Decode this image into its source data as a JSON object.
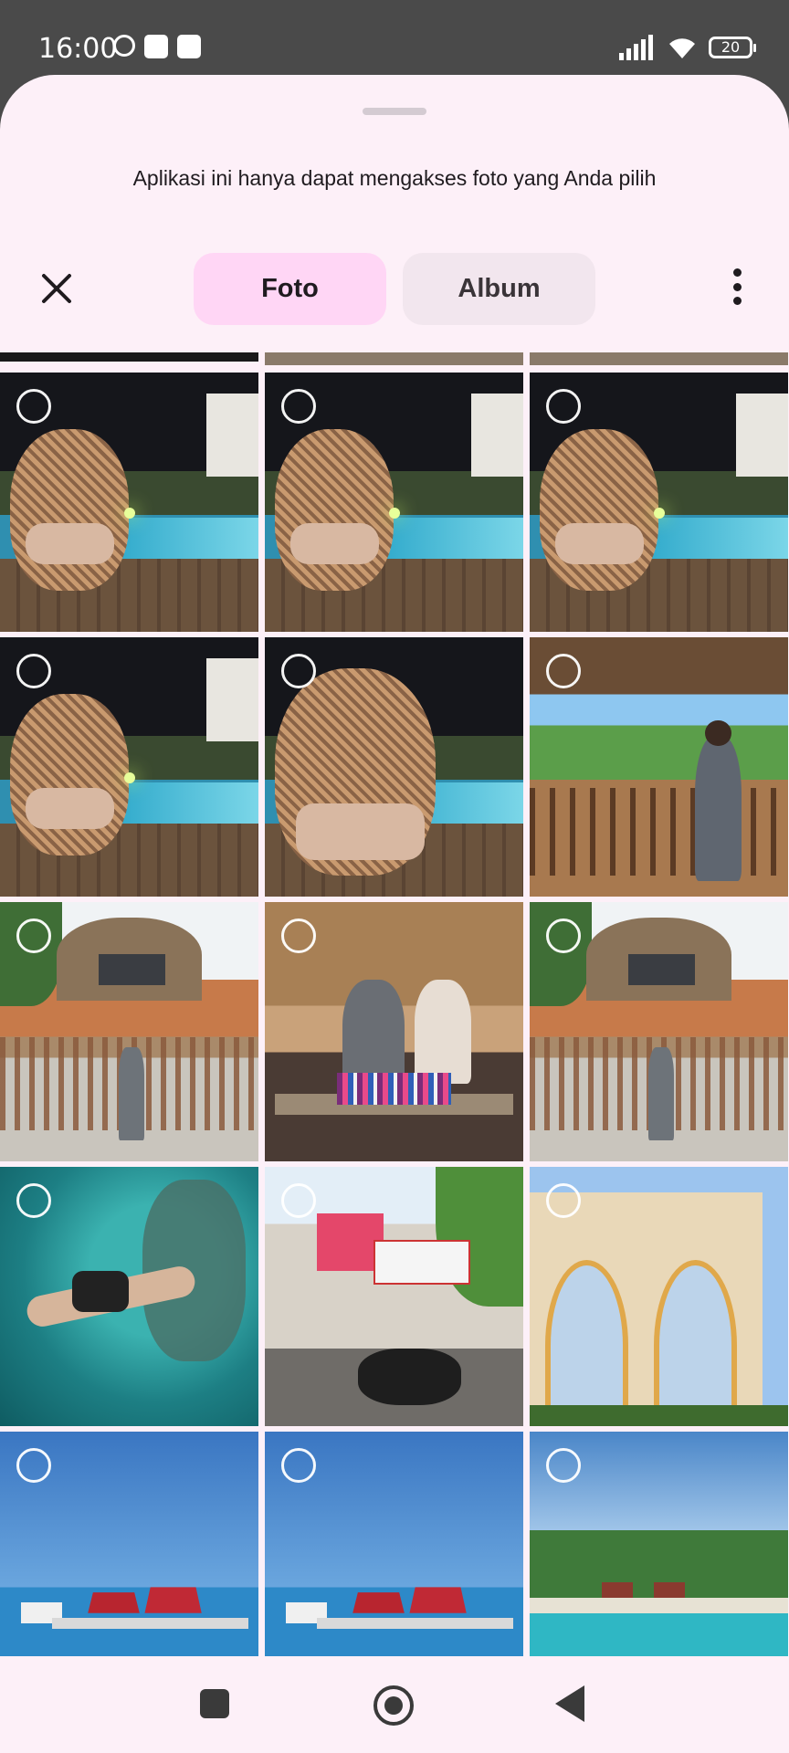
{
  "status_bar": {
    "time": "16:00",
    "battery": "20",
    "icons": [
      "alarm-icon",
      "message-icon",
      "upload-icon",
      "signal-icon",
      "wifi-icon",
      "battery-icon"
    ]
  },
  "sheet": {
    "notice": "Aplikasi ini hanya dapat mengakses foto yang Anda pilih",
    "tabs": [
      {
        "label": "Foto",
        "selected": true
      },
      {
        "label": "Album",
        "selected": false
      }
    ]
  },
  "grid": {
    "photos": [
      {
        "scene": "night-pool-chair"
      },
      {
        "scene": "night-pool-chair"
      },
      {
        "scene": "night-pool-chair"
      },
      {
        "scene": "night-pool-chair"
      },
      {
        "scene": "night-pool-chair-closeup"
      },
      {
        "scene": "man-on-hut-balcony"
      },
      {
        "scene": "sade-village-gate"
      },
      {
        "scene": "two-people-weaving"
      },
      {
        "scene": "sade-village-gate"
      },
      {
        "scene": "underwater-diver"
      },
      {
        "scene": "street-shop"
      },
      {
        "scene": "arched-building"
      },
      {
        "scene": "harbor-red-roofs"
      },
      {
        "scene": "harbor-red-roofs"
      },
      {
        "scene": "beach-resort"
      }
    ]
  },
  "colors": {
    "sheet_bg": "#fdf0f8",
    "tab_selected": "#ffd6f5",
    "tab_unselected": "#f2e6ee",
    "status_bar_bg": "#4a4a4a"
  }
}
